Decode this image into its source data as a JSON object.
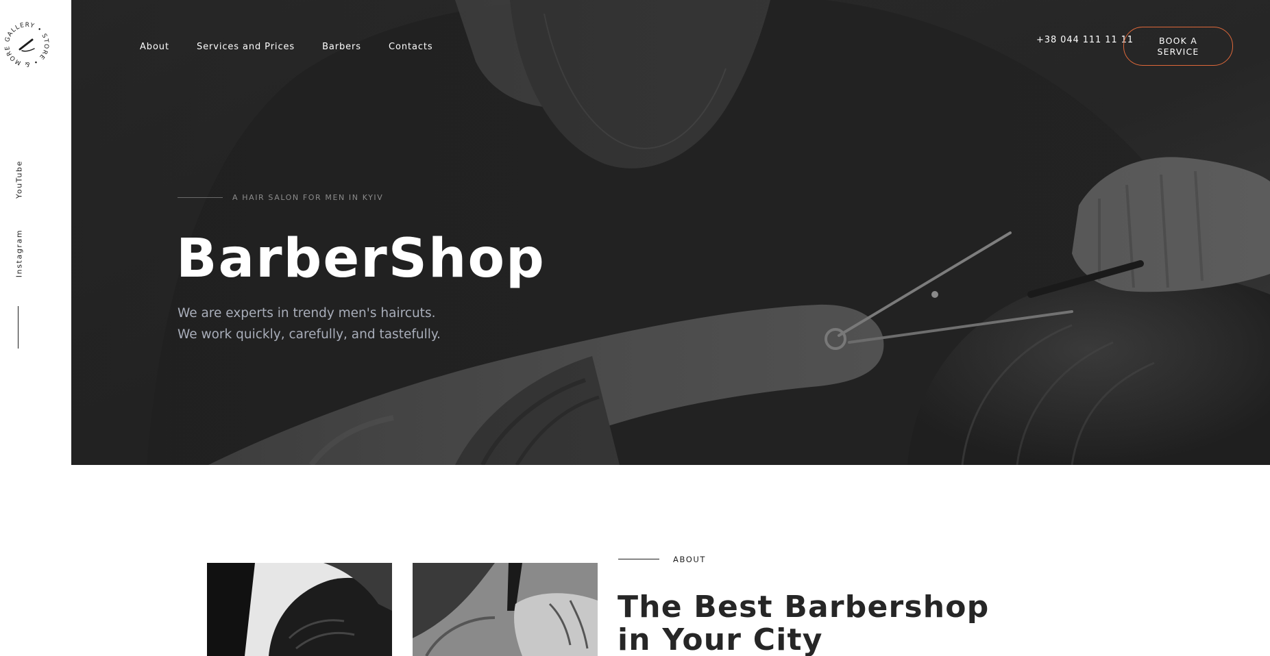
{
  "sidebar": {
    "logo_text": "GALLERY • STORE • & MORE •",
    "social": [
      "YouTube",
      "Instagram"
    ]
  },
  "nav": {
    "items": [
      "About",
      "Services and Prices",
      "Barbers",
      "Contacts"
    ],
    "phone": "+38 044 111 11 11",
    "book_button": "BOOK A SERVICE"
  },
  "hero": {
    "eyebrow": "A HAIR SALON FOR MEN IN KYIV",
    "title": "BarberShop",
    "subtitle_lines": [
      "We are experts in trendy men's haircuts.",
      "We work quickly, carefully, and tastefully."
    ]
  },
  "about": {
    "label": "ABOUT",
    "title": "The Best Barbershop in Your City"
  },
  "colors": {
    "accent": "#e0693a",
    "hero_overlay": "#2a2a2a",
    "subtitle": "#a9aeba"
  }
}
